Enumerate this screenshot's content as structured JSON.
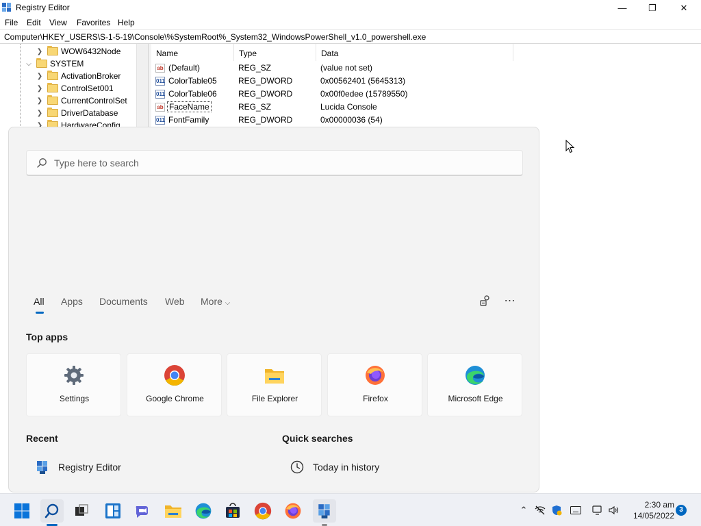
{
  "window": {
    "title": "Registry Editor",
    "controls": {
      "minimize": "—",
      "maximize": "❐",
      "close": "✕"
    }
  },
  "menu": [
    "File",
    "Edit",
    "View",
    "Favorites",
    "Help"
  ],
  "address": "Computer\\HKEY_USERS\\S-1-5-19\\Console\\%SystemRoot%_System32_WindowsPowerShell_v1.0_powershell.exe",
  "tree": [
    {
      "label": "WOW6432Node",
      "expanded": false
    },
    {
      "label": "SYSTEM",
      "expanded": true
    },
    {
      "label": "ActivationBroker",
      "expanded": false
    },
    {
      "label": "ControlSet001",
      "expanded": false
    },
    {
      "label": "CurrentControlSet",
      "expanded": false
    },
    {
      "label": "DriverDatabase",
      "expanded": false
    },
    {
      "label": "HardwareConfig",
      "expanded": false
    }
  ],
  "columns": {
    "name": "Name",
    "type": "Type",
    "data": "Data"
  },
  "values": [
    {
      "icon": "ab",
      "name": "(Default)",
      "type": "REG_SZ",
      "data": "(value not set)"
    },
    {
      "icon": "011",
      "name": "ColorTable05",
      "type": "REG_DWORD",
      "data": "0x00562401 (5645313)"
    },
    {
      "icon": "011",
      "name": "ColorTable06",
      "type": "REG_DWORD",
      "data": "0x00f0edee (15789550)"
    },
    {
      "icon": "ab",
      "name": "FaceName",
      "type": "REG_SZ",
      "data": "Lucida Console"
    },
    {
      "icon": "011",
      "name": "FontFamily",
      "type": "REG_DWORD",
      "data": "0x00000036 (54)"
    }
  ],
  "search": {
    "placeholder": "Type here to search",
    "tabs": [
      "All",
      "Apps",
      "Documents",
      "Web",
      "More"
    ],
    "active_tab": "All",
    "top_apps_title": "Top apps",
    "top_apps": [
      {
        "label": "Settings",
        "icon": "settings-icon"
      },
      {
        "label": "Google Chrome",
        "icon": "chrome-icon"
      },
      {
        "label": "File Explorer",
        "icon": "file-explorer-icon"
      },
      {
        "label": "Firefox",
        "icon": "firefox-icon"
      },
      {
        "label": "Microsoft Edge",
        "icon": "edge-icon"
      }
    ],
    "recent_title": "Recent",
    "recent": [
      {
        "label": "Registry Editor",
        "icon": "registry-editor-icon"
      }
    ],
    "quick_title": "Quick searches",
    "quick": [
      {
        "label": "Today in history",
        "icon": "clock-icon"
      }
    ]
  },
  "taskbar": {
    "apps": [
      "start",
      "search",
      "task-view",
      "widgets",
      "teams-chat",
      "file-explorer",
      "edge",
      "store",
      "chrome",
      "firefox",
      "registry-editor"
    ],
    "clock_time": "2:30 am",
    "clock_date": "14/05/2022",
    "notification_count": "3"
  },
  "colors": {
    "accent": "#0067c0",
    "panel_bg": "#f3f3f3",
    "taskbar_bg": "#eef0f5"
  }
}
